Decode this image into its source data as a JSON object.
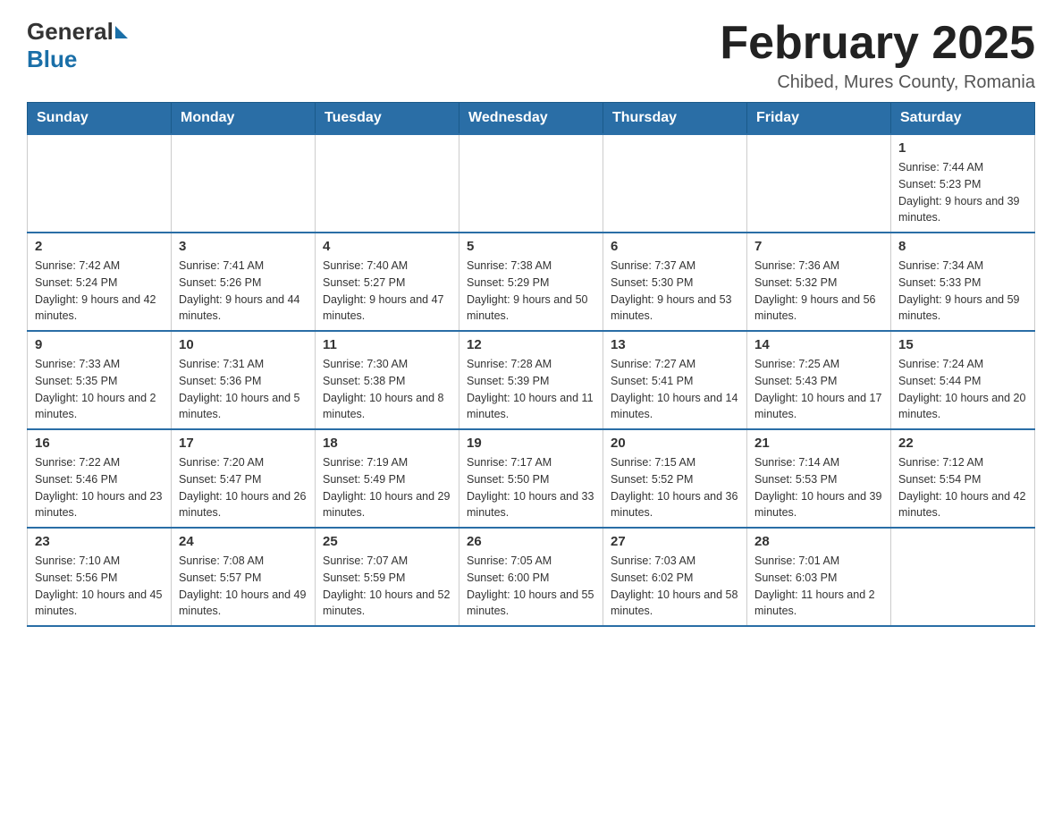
{
  "header": {
    "logo_general": "General",
    "logo_blue": "Blue",
    "title": "February 2025",
    "subtitle": "Chibed, Mures County, Romania"
  },
  "weekdays": [
    "Sunday",
    "Monday",
    "Tuesday",
    "Wednesday",
    "Thursday",
    "Friday",
    "Saturday"
  ],
  "weeks": [
    [
      {
        "day": "",
        "info": ""
      },
      {
        "day": "",
        "info": ""
      },
      {
        "day": "",
        "info": ""
      },
      {
        "day": "",
        "info": ""
      },
      {
        "day": "",
        "info": ""
      },
      {
        "day": "",
        "info": ""
      },
      {
        "day": "1",
        "info": "Sunrise: 7:44 AM\nSunset: 5:23 PM\nDaylight: 9 hours and 39 minutes."
      }
    ],
    [
      {
        "day": "2",
        "info": "Sunrise: 7:42 AM\nSunset: 5:24 PM\nDaylight: 9 hours and 42 minutes."
      },
      {
        "day": "3",
        "info": "Sunrise: 7:41 AM\nSunset: 5:26 PM\nDaylight: 9 hours and 44 minutes."
      },
      {
        "day": "4",
        "info": "Sunrise: 7:40 AM\nSunset: 5:27 PM\nDaylight: 9 hours and 47 minutes."
      },
      {
        "day": "5",
        "info": "Sunrise: 7:38 AM\nSunset: 5:29 PM\nDaylight: 9 hours and 50 minutes."
      },
      {
        "day": "6",
        "info": "Sunrise: 7:37 AM\nSunset: 5:30 PM\nDaylight: 9 hours and 53 minutes."
      },
      {
        "day": "7",
        "info": "Sunrise: 7:36 AM\nSunset: 5:32 PM\nDaylight: 9 hours and 56 minutes."
      },
      {
        "day": "8",
        "info": "Sunrise: 7:34 AM\nSunset: 5:33 PM\nDaylight: 9 hours and 59 minutes."
      }
    ],
    [
      {
        "day": "9",
        "info": "Sunrise: 7:33 AM\nSunset: 5:35 PM\nDaylight: 10 hours and 2 minutes."
      },
      {
        "day": "10",
        "info": "Sunrise: 7:31 AM\nSunset: 5:36 PM\nDaylight: 10 hours and 5 minutes."
      },
      {
        "day": "11",
        "info": "Sunrise: 7:30 AM\nSunset: 5:38 PM\nDaylight: 10 hours and 8 minutes."
      },
      {
        "day": "12",
        "info": "Sunrise: 7:28 AM\nSunset: 5:39 PM\nDaylight: 10 hours and 11 minutes."
      },
      {
        "day": "13",
        "info": "Sunrise: 7:27 AM\nSunset: 5:41 PM\nDaylight: 10 hours and 14 minutes."
      },
      {
        "day": "14",
        "info": "Sunrise: 7:25 AM\nSunset: 5:43 PM\nDaylight: 10 hours and 17 minutes."
      },
      {
        "day": "15",
        "info": "Sunrise: 7:24 AM\nSunset: 5:44 PM\nDaylight: 10 hours and 20 minutes."
      }
    ],
    [
      {
        "day": "16",
        "info": "Sunrise: 7:22 AM\nSunset: 5:46 PM\nDaylight: 10 hours and 23 minutes."
      },
      {
        "day": "17",
        "info": "Sunrise: 7:20 AM\nSunset: 5:47 PM\nDaylight: 10 hours and 26 minutes."
      },
      {
        "day": "18",
        "info": "Sunrise: 7:19 AM\nSunset: 5:49 PM\nDaylight: 10 hours and 29 minutes."
      },
      {
        "day": "19",
        "info": "Sunrise: 7:17 AM\nSunset: 5:50 PM\nDaylight: 10 hours and 33 minutes."
      },
      {
        "day": "20",
        "info": "Sunrise: 7:15 AM\nSunset: 5:52 PM\nDaylight: 10 hours and 36 minutes."
      },
      {
        "day": "21",
        "info": "Sunrise: 7:14 AM\nSunset: 5:53 PM\nDaylight: 10 hours and 39 minutes."
      },
      {
        "day": "22",
        "info": "Sunrise: 7:12 AM\nSunset: 5:54 PM\nDaylight: 10 hours and 42 minutes."
      }
    ],
    [
      {
        "day": "23",
        "info": "Sunrise: 7:10 AM\nSunset: 5:56 PM\nDaylight: 10 hours and 45 minutes."
      },
      {
        "day": "24",
        "info": "Sunrise: 7:08 AM\nSunset: 5:57 PM\nDaylight: 10 hours and 49 minutes."
      },
      {
        "day": "25",
        "info": "Sunrise: 7:07 AM\nSunset: 5:59 PM\nDaylight: 10 hours and 52 minutes."
      },
      {
        "day": "26",
        "info": "Sunrise: 7:05 AM\nSunset: 6:00 PM\nDaylight: 10 hours and 55 minutes."
      },
      {
        "day": "27",
        "info": "Sunrise: 7:03 AM\nSunset: 6:02 PM\nDaylight: 10 hours and 58 minutes."
      },
      {
        "day": "28",
        "info": "Sunrise: 7:01 AM\nSunset: 6:03 PM\nDaylight: 11 hours and 2 minutes."
      },
      {
        "day": "",
        "info": ""
      }
    ]
  ]
}
